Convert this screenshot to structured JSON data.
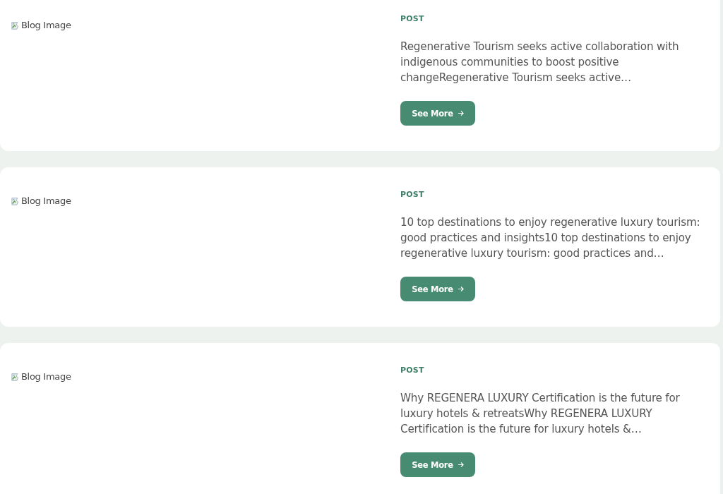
{
  "posts": [
    {
      "image_alt": "Blog Image",
      "category": "POST",
      "excerpt": "Regenerative Tourism seeks active collaboration with indigenous communities to boost positive changeRegenerative Tourism seeks active…",
      "button": "See More"
    },
    {
      "image_alt": "Blog Image",
      "category": "POST",
      "excerpt": "10 top destinations to enjoy regenerative luxury tourism: good practices and insights10 top destinations to enjoy regenerative luxury tourism: good practices and…",
      "button": "See More"
    },
    {
      "image_alt": "Blog Image",
      "category": "POST",
      "excerpt": "Why REGENERA LUXURY Certification is the future for luxury hotels & retreatsWhy REGENERA LUXURY Certification is the future for luxury hotels &…",
      "button": "See More"
    }
  ]
}
